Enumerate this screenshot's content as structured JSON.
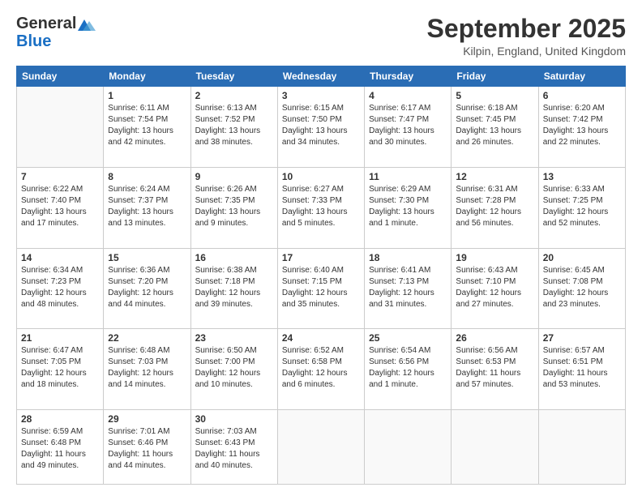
{
  "header": {
    "logo_line1": "General",
    "logo_line2": "Blue",
    "month_title": "September 2025",
    "location": "Kilpin, England, United Kingdom"
  },
  "weekdays": [
    "Sunday",
    "Monday",
    "Tuesday",
    "Wednesday",
    "Thursday",
    "Friday",
    "Saturday"
  ],
  "weeks": [
    [
      {
        "day": "",
        "info": ""
      },
      {
        "day": "1",
        "info": "Sunrise: 6:11 AM\nSunset: 7:54 PM\nDaylight: 13 hours\nand 42 minutes."
      },
      {
        "day": "2",
        "info": "Sunrise: 6:13 AM\nSunset: 7:52 PM\nDaylight: 13 hours\nand 38 minutes."
      },
      {
        "day": "3",
        "info": "Sunrise: 6:15 AM\nSunset: 7:50 PM\nDaylight: 13 hours\nand 34 minutes."
      },
      {
        "day": "4",
        "info": "Sunrise: 6:17 AM\nSunset: 7:47 PM\nDaylight: 13 hours\nand 30 minutes."
      },
      {
        "day": "5",
        "info": "Sunrise: 6:18 AM\nSunset: 7:45 PM\nDaylight: 13 hours\nand 26 minutes."
      },
      {
        "day": "6",
        "info": "Sunrise: 6:20 AM\nSunset: 7:42 PM\nDaylight: 13 hours\nand 22 minutes."
      }
    ],
    [
      {
        "day": "7",
        "info": "Sunrise: 6:22 AM\nSunset: 7:40 PM\nDaylight: 13 hours\nand 17 minutes."
      },
      {
        "day": "8",
        "info": "Sunrise: 6:24 AM\nSunset: 7:37 PM\nDaylight: 13 hours\nand 13 minutes."
      },
      {
        "day": "9",
        "info": "Sunrise: 6:26 AM\nSunset: 7:35 PM\nDaylight: 13 hours\nand 9 minutes."
      },
      {
        "day": "10",
        "info": "Sunrise: 6:27 AM\nSunset: 7:33 PM\nDaylight: 13 hours\nand 5 minutes."
      },
      {
        "day": "11",
        "info": "Sunrise: 6:29 AM\nSunset: 7:30 PM\nDaylight: 13 hours\nand 1 minute."
      },
      {
        "day": "12",
        "info": "Sunrise: 6:31 AM\nSunset: 7:28 PM\nDaylight: 12 hours\nand 56 minutes."
      },
      {
        "day": "13",
        "info": "Sunrise: 6:33 AM\nSunset: 7:25 PM\nDaylight: 12 hours\nand 52 minutes."
      }
    ],
    [
      {
        "day": "14",
        "info": "Sunrise: 6:34 AM\nSunset: 7:23 PM\nDaylight: 12 hours\nand 48 minutes."
      },
      {
        "day": "15",
        "info": "Sunrise: 6:36 AM\nSunset: 7:20 PM\nDaylight: 12 hours\nand 44 minutes."
      },
      {
        "day": "16",
        "info": "Sunrise: 6:38 AM\nSunset: 7:18 PM\nDaylight: 12 hours\nand 39 minutes."
      },
      {
        "day": "17",
        "info": "Sunrise: 6:40 AM\nSunset: 7:15 PM\nDaylight: 12 hours\nand 35 minutes."
      },
      {
        "day": "18",
        "info": "Sunrise: 6:41 AM\nSunset: 7:13 PM\nDaylight: 12 hours\nand 31 minutes."
      },
      {
        "day": "19",
        "info": "Sunrise: 6:43 AM\nSunset: 7:10 PM\nDaylight: 12 hours\nand 27 minutes."
      },
      {
        "day": "20",
        "info": "Sunrise: 6:45 AM\nSunset: 7:08 PM\nDaylight: 12 hours\nand 23 minutes."
      }
    ],
    [
      {
        "day": "21",
        "info": "Sunrise: 6:47 AM\nSunset: 7:05 PM\nDaylight: 12 hours\nand 18 minutes."
      },
      {
        "day": "22",
        "info": "Sunrise: 6:48 AM\nSunset: 7:03 PM\nDaylight: 12 hours\nand 14 minutes."
      },
      {
        "day": "23",
        "info": "Sunrise: 6:50 AM\nSunset: 7:00 PM\nDaylight: 12 hours\nand 10 minutes."
      },
      {
        "day": "24",
        "info": "Sunrise: 6:52 AM\nSunset: 6:58 PM\nDaylight: 12 hours\nand 6 minutes."
      },
      {
        "day": "25",
        "info": "Sunrise: 6:54 AM\nSunset: 6:56 PM\nDaylight: 12 hours\nand 1 minute."
      },
      {
        "day": "26",
        "info": "Sunrise: 6:56 AM\nSunset: 6:53 PM\nDaylight: 11 hours\nand 57 minutes."
      },
      {
        "day": "27",
        "info": "Sunrise: 6:57 AM\nSunset: 6:51 PM\nDaylight: 11 hours\nand 53 minutes."
      }
    ],
    [
      {
        "day": "28",
        "info": "Sunrise: 6:59 AM\nSunset: 6:48 PM\nDaylight: 11 hours\nand 49 minutes."
      },
      {
        "day": "29",
        "info": "Sunrise: 7:01 AM\nSunset: 6:46 PM\nDaylight: 11 hours\nand 44 minutes."
      },
      {
        "day": "30",
        "info": "Sunrise: 7:03 AM\nSunset: 6:43 PM\nDaylight: 11 hours\nand 40 minutes."
      },
      {
        "day": "",
        "info": ""
      },
      {
        "day": "",
        "info": ""
      },
      {
        "day": "",
        "info": ""
      },
      {
        "day": "",
        "info": ""
      }
    ]
  ]
}
